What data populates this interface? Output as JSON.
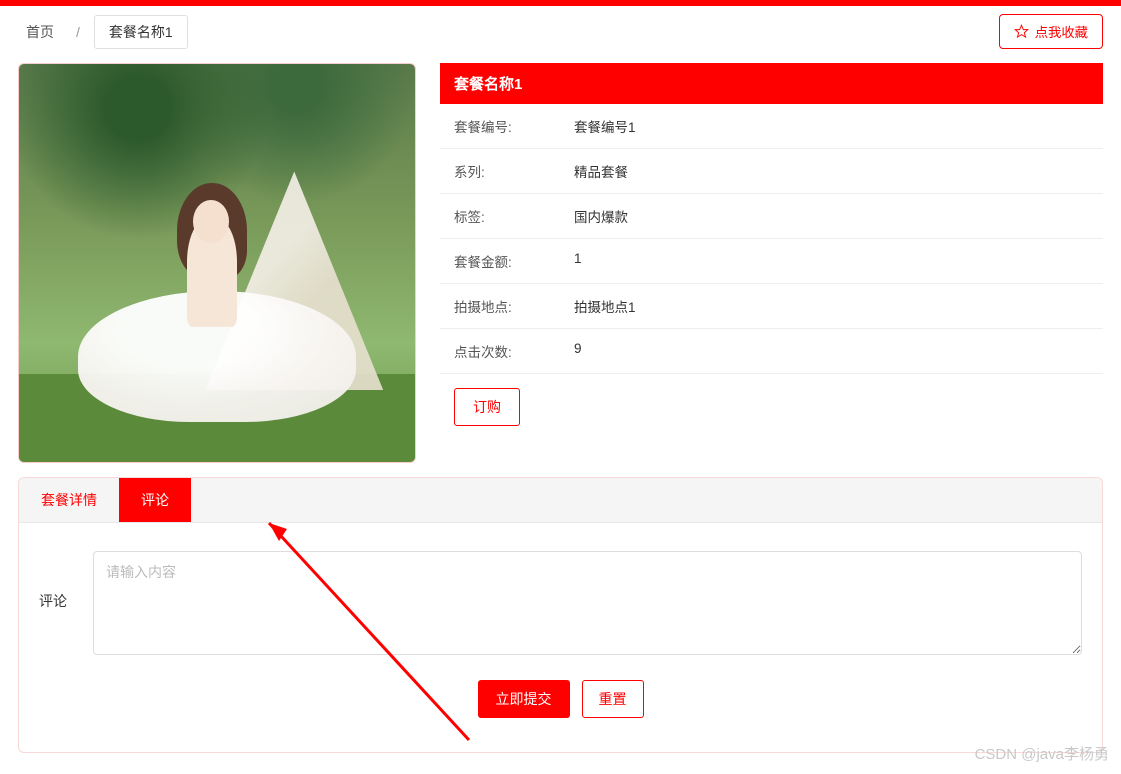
{
  "breadcrumb": {
    "home": "首页",
    "sep": "/",
    "current": "套餐名称1"
  },
  "favorite_label": "点我收藏",
  "product": {
    "title": "套餐名称1",
    "rows": [
      {
        "label": "套餐编号:",
        "value": "套餐编号1"
      },
      {
        "label": "系列:",
        "value": "精品套餐"
      },
      {
        "label": "标签:",
        "value": "国内爆款"
      },
      {
        "label": "套餐金额:",
        "value": "1"
      },
      {
        "label": "拍摄地点:",
        "value": "拍摄地点1"
      },
      {
        "label": "点击次数:",
        "value": "9"
      }
    ],
    "order_btn": "订购"
  },
  "tabs": {
    "detail": "套餐详情",
    "comment": "评论"
  },
  "comment_form": {
    "label": "评论",
    "placeholder": "请输入内容",
    "submit": "立即提交",
    "reset": "重置"
  },
  "watermark": "CSDN @java李杨勇"
}
